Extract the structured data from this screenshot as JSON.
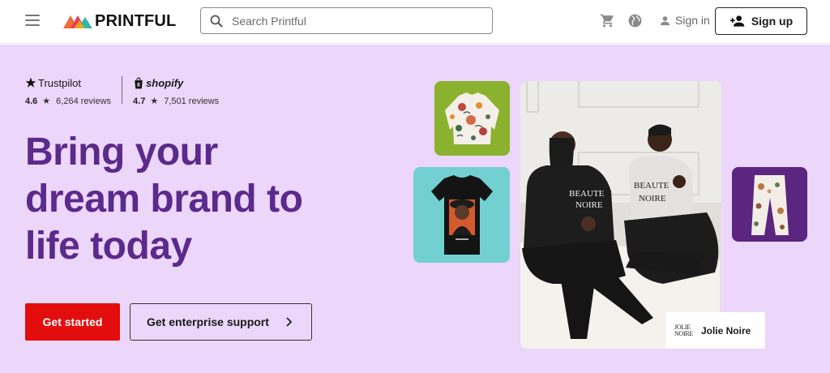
{
  "header": {
    "logo_text": "PRINTFUL",
    "search_placeholder": "Search Printful",
    "sign_in_label": "Sign in",
    "sign_up_label": "Sign up",
    "icons": [
      "menu-icon",
      "cart-icon",
      "globe-icon",
      "user-icon",
      "add-user-icon",
      "search-icon"
    ]
  },
  "ratings": {
    "trustpilot": {
      "brand": "Trustpilot",
      "score": "4.6",
      "reviews": "6,264 reviews"
    },
    "shopify": {
      "brand": "shopify",
      "score": "4.7",
      "reviews": "7,501 reviews"
    }
  },
  "hero": {
    "headline_lines": [
      "Bring your",
      "dream brand to",
      "life today"
    ],
    "primary_cta": "Get started",
    "secondary_cta": "Get enterprise support",
    "background_color": "#ecd6fa",
    "headline_color": "#5b2a8c",
    "primary_color": "#e30d0d"
  },
  "showcase": {
    "brand_card_logo_line1": "JOLIE",
    "brand_card_logo_line2": "NOIRE",
    "brand_card_name": "Jolie Noire",
    "shirt_text_left_1": "BEAUTE",
    "shirt_text_left_2": "NOIRE",
    "shirt_text_right_1": "BEAUTE",
    "shirt_text_right_2": "NOIRE",
    "tile_colors": {
      "sweater": "#8ab22e",
      "tee": "#72d0d2",
      "pants": "#5a2680"
    }
  }
}
